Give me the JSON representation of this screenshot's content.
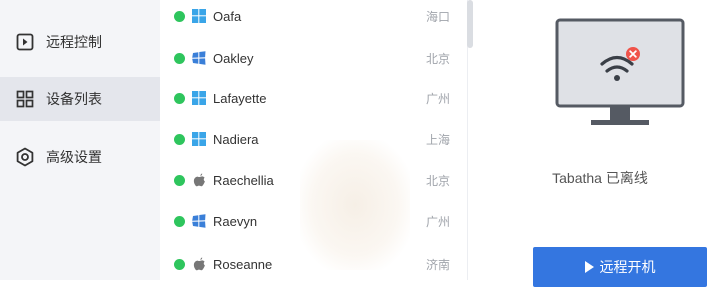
{
  "sidebar": {
    "items": [
      {
        "label": "远程控制",
        "icon": "remote-control-icon",
        "active": false
      },
      {
        "label": "设备列表",
        "icon": "device-list-icon",
        "active": true
      },
      {
        "label": "高级设置",
        "icon": "gear-icon",
        "active": false
      }
    ]
  },
  "devices": [
    {
      "name": "Oafa",
      "os": "windows-icon",
      "city": "海口",
      "online": true
    },
    {
      "name": "Oakley",
      "os": "windows-legacy-icon",
      "city": "北京",
      "online": true
    },
    {
      "name": "Lafayette",
      "os": "windows-icon",
      "city": "广州",
      "online": true
    },
    {
      "name": "Nadiera",
      "os": "windows-icon",
      "city": "上海",
      "online": true
    },
    {
      "name": "Raechellia",
      "os": "apple-icon",
      "city": "北京",
      "online": true
    },
    {
      "name": "Raevyn",
      "os": "windows-legacy-icon",
      "city": "广州",
      "online": true
    },
    {
      "name": "Roseanne",
      "os": "apple-icon",
      "city": "济南",
      "online": true
    }
  ],
  "detail": {
    "status_text": "Tabatha 已离线",
    "button_label": "远程开机"
  },
  "colors": {
    "online": "#2ec55d",
    "accent": "#3476e0",
    "offline_badge": "#f0534a"
  }
}
